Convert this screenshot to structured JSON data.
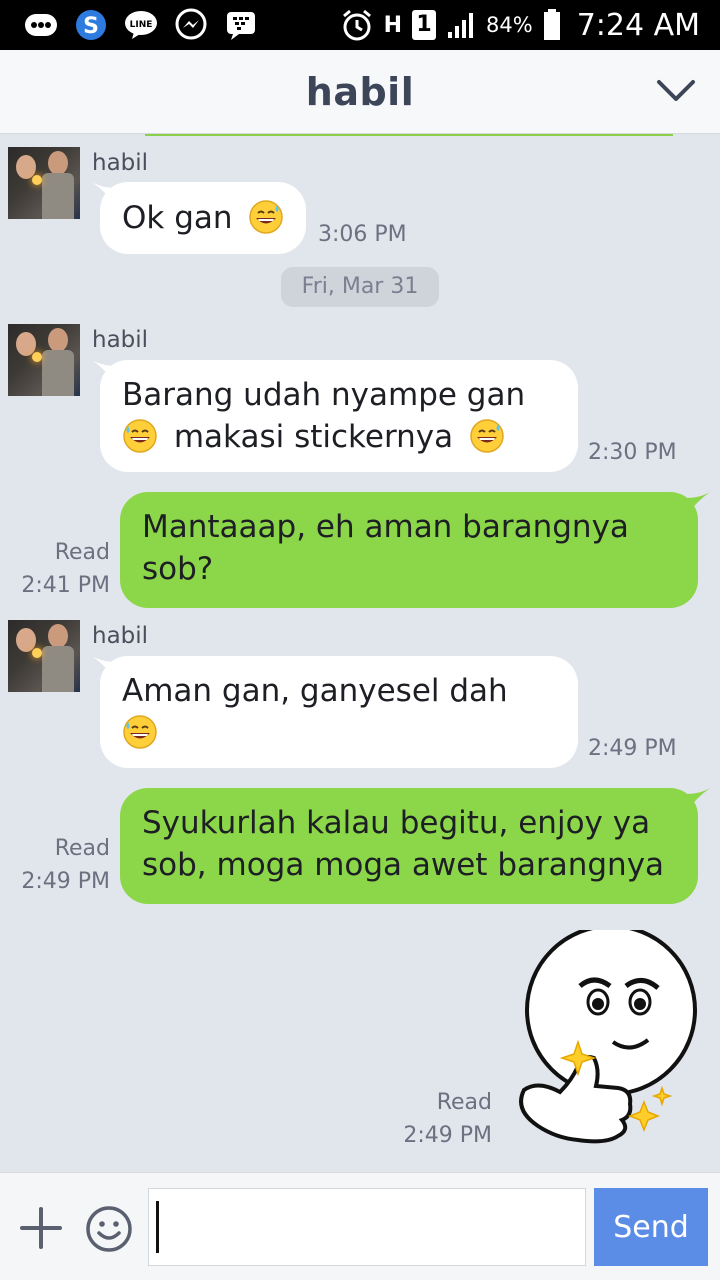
{
  "status_bar": {
    "battery": "84%",
    "time": "7:24 AM",
    "network_label": "H",
    "sim_label": "1",
    "left_icons": [
      "messenger-dots-icon",
      "skype-icon",
      "line-icon",
      "facebook-messenger-icon",
      "bbm-icon"
    ],
    "right_icons": [
      "alarm-icon",
      "network-h-icon",
      "sim-1-icon",
      "signal-icon",
      "battery-icon"
    ]
  },
  "header": {
    "title": "habil",
    "chevron_icon": "chevron-down-icon"
  },
  "chat": {
    "date_divider": "Fri, Mar 31",
    "messages": [
      {
        "direction": "in",
        "sender": "habil",
        "text_line1": "Ok gan",
        "emoji": "grinning-sweat",
        "time": "3:06 PM"
      },
      {
        "direction": "in",
        "sender": "habil",
        "text_line1": "Barang udah nyampe gan",
        "text_line2": "makasi stickernya",
        "emoji": "grinning-sweat",
        "time": "2:30 PM"
      },
      {
        "direction": "out",
        "text_line1": "Mantaaap, eh aman barangnya",
        "text_line2": "sob?",
        "read_label": "Read",
        "time": "2:41 PM"
      },
      {
        "direction": "in",
        "sender": "habil",
        "text_line1": "Aman gan, ganyesel dah",
        "emoji": "grinning-sweat",
        "time": "2:49 PM"
      },
      {
        "direction": "out",
        "text_line1": "Syukurlah kalau begitu, enjoy ya",
        "text_line2": "sob, moga moga awet barangnya",
        "read_label": "Read",
        "time": "2:49 PM"
      },
      {
        "direction": "out",
        "type": "sticker",
        "sticker": "thumbs-up-smug-face-sticker",
        "read_label": "Read",
        "time": "2:49 PM"
      }
    ]
  },
  "input_bar": {
    "message_value": "",
    "send_label": "Send",
    "plus_icon": "plus-icon",
    "emoji_icon": "smiley-icon"
  },
  "colors": {
    "background": "#e1e5ec",
    "incoming_bubble": "#ffffff",
    "outgoing_bubble": "#8cd64a",
    "send_button": "#5b8de6",
    "header_title": "#3d4559"
  }
}
